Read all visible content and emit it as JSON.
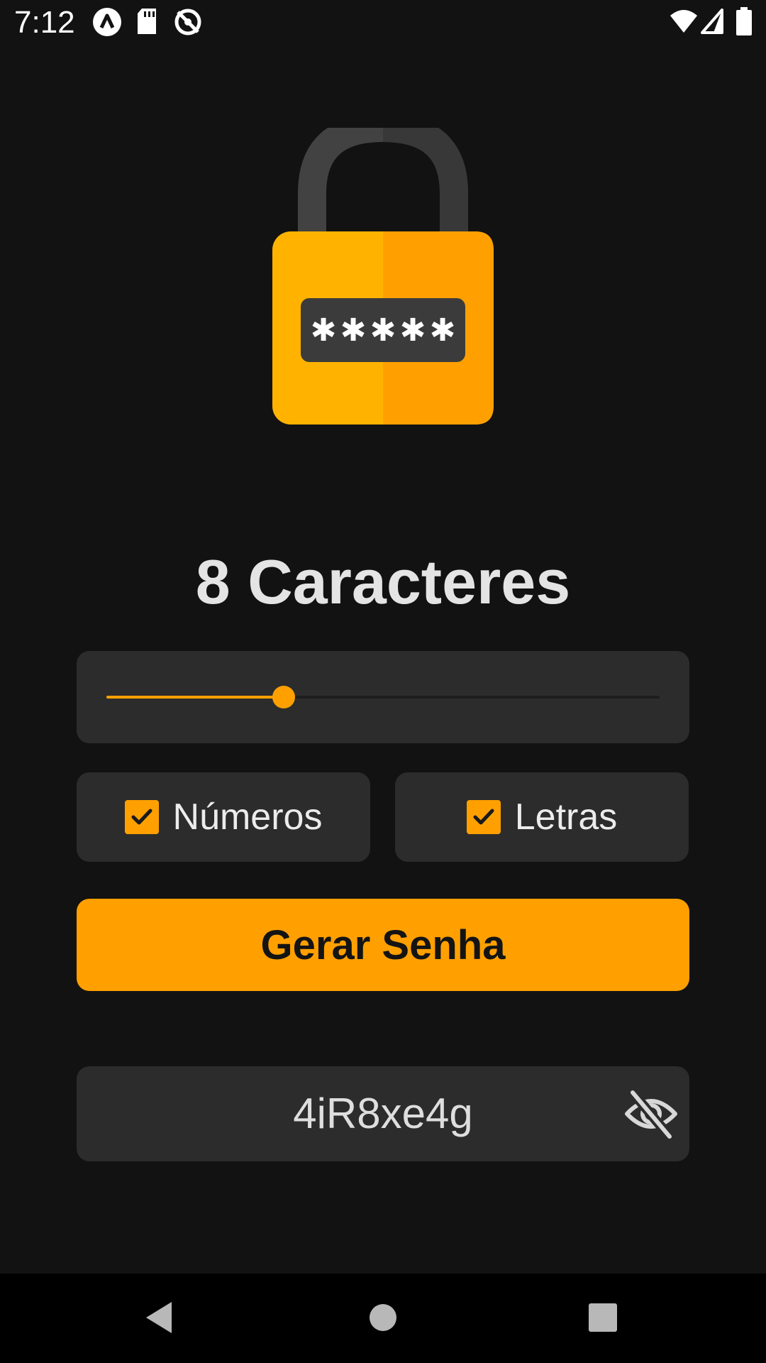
{
  "status_bar": {
    "time": "7:12",
    "icons_left": [
      "app-a-icon",
      "sd-card-icon",
      "sync-off-icon"
    ],
    "icons_right": [
      "wifi-icon",
      "signal-icon",
      "battery-icon"
    ]
  },
  "hero": {
    "icon": "padlock-password-icon",
    "accent_color": "#FFA000"
  },
  "length": {
    "label": "8 Caracteres",
    "value": 8,
    "slider_fraction": 0.32
  },
  "options": {
    "numbers": {
      "label": "Números",
      "checked": true
    },
    "letters": {
      "label": "Letras",
      "checked": true
    }
  },
  "generate_button": {
    "label": "Gerar Senha"
  },
  "output": {
    "password": "4iR8xe4g",
    "visibility_icon": "eye-off-icon"
  },
  "nav_bar": {
    "buttons": [
      "back-icon",
      "home-icon",
      "recents-icon"
    ]
  },
  "colors": {
    "background": "#121212",
    "card": "#2C2C2C",
    "accent": "#FFA000",
    "text": "#E4E4E4"
  }
}
